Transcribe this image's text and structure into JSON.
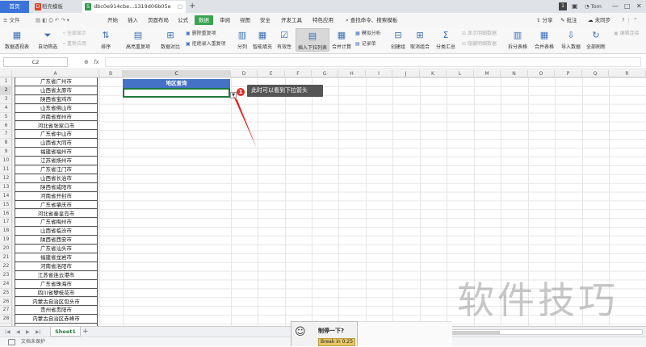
{
  "tabs": {
    "home": "首页",
    "docer": "稻壳模板",
    "file": "dbc0e914cbe...1319d06b05e",
    "add": "+"
  },
  "window": {
    "badge": "1",
    "user": "Tom"
  },
  "menu": {
    "hamburger": "≡ 文件",
    "items": [
      "开始",
      "插入",
      "页面布局",
      "公式",
      "数据",
      "审阅",
      "视图",
      "安全",
      "开发工具",
      "特色应用"
    ],
    "active": "数据",
    "search": "查找命令、搜索模板",
    "right": [
      "分享",
      "批注",
      "未同步"
    ]
  },
  "ribbon": {
    "pivot": "数据透视表",
    "autofilter": "自动筛选",
    "show_all": "全部显示",
    "reapply": "重新应用",
    "sort": "排序",
    "highlight_dup": "高亮重复项",
    "data_compare": "数据对比",
    "remove_dup": "删除重复项",
    "reject_dup": "拒绝录入重复项",
    "split": "分列",
    "smart_fill": "智能填充",
    "validity": "有效性",
    "dropdown_list": "插入下拉列表",
    "consolidate": "合并计算",
    "what_if": "模拟分析",
    "record_form": "记录单",
    "group": "创建组",
    "ungroup": "取消组合",
    "subtotal": "分类汇总",
    "show_detail": "显示明细数据",
    "hide_detail": "隐藏明细数据",
    "split_table": "拆分表格",
    "merge_table": "合并表格",
    "import_data": "导入数据",
    "refresh_all": "全部刷新",
    "edit_links": "编辑连接"
  },
  "formula_bar": {
    "name_box": "C2",
    "fx": "fx",
    "content": ""
  },
  "columns": [
    "A",
    "B",
    "C",
    "D",
    "E",
    "F",
    "G",
    "H",
    "I",
    "J",
    "K",
    "L",
    "M",
    "N",
    "O",
    "P",
    "Q",
    "R"
  ],
  "rows": [
    "1",
    "2",
    "3",
    "4",
    "5",
    "6",
    "7",
    "8",
    "9",
    "10",
    "11",
    "12",
    "13",
    "14",
    "15",
    "16",
    "17",
    "18",
    "19",
    "20",
    "21",
    "22",
    "23",
    "24",
    "25",
    "26",
    "27",
    "28"
  ],
  "cities": [
    "广东省广州市",
    "山西省太原市",
    "陕西省宝鸡市",
    "山东省佛山市",
    "河南省郑州市",
    "河北省张家口市",
    "广东省中山市",
    "山西省大同市",
    "福建省福州市",
    "江苏省扬州市",
    "广东省江门市",
    "山西省长治市",
    "陕西省咸阳市",
    "河南省开封市",
    "广东省肇庆市",
    "河北省秦皇岛市",
    "广东省梅州市",
    "山西省临汾市",
    "陕西省西安市",
    "广东省汕头市",
    "福建省龙岩市",
    "河南省洛阳市",
    "江苏省连云港市",
    "广东省珠海市",
    "四川省攀枝花市",
    "内蒙古自治区包头市",
    "贵州省贵阳市",
    "内蒙古自治区赤峰市"
  ],
  "region_header": "地区查询",
  "callout": {
    "number": "1",
    "text": "此时可以看到下拉箭头"
  },
  "sheet": {
    "name": "Sheet1",
    "add": "+"
  },
  "status": "文档未保护",
  "break_popup": {
    "title": "制停一下?",
    "timer": "Break in 0:25"
  },
  "watermark": "软件技巧"
}
